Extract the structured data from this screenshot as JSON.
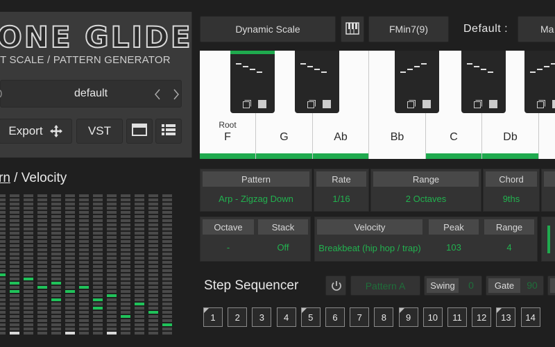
{
  "app": {
    "logo": "ONE GLIDE",
    "subtitle": "T SCALE / PATTERN GENERATOR"
  },
  "preset": {
    "name": "default"
  },
  "left_buttons": {
    "export": "Export",
    "vst": "VST"
  },
  "topbar": {
    "mode": "Dynamic Scale",
    "chord": "FMin7(9)",
    "default_label": "Default :",
    "default_value": "Ma"
  },
  "piano": {
    "root_label": "Root",
    "white_keys": [
      {
        "note": "F",
        "active": true
      },
      {
        "note": "G",
        "active": true
      },
      {
        "note": "Ab",
        "active": true
      },
      {
        "note": "Bb",
        "active": false
      },
      {
        "note": "C",
        "active": true
      },
      {
        "note": "Db",
        "active": true
      }
    ],
    "black_keys_active": [
      true,
      false,
      false,
      false,
      false
    ]
  },
  "pattern_velocity": {
    "title_a": "rn",
    "title_sep": " / ",
    "title_b": "Velocity"
  },
  "params": {
    "row1": [
      {
        "header": "Pattern",
        "value": "Arp - Zigzag Down"
      },
      {
        "header": "Rate",
        "value": "1/16"
      },
      {
        "header": "Range",
        "value": "2 Octaves"
      },
      {
        "header": "Chord",
        "value": "9ths"
      }
    ],
    "row2": [
      {
        "header": "Octave",
        "value": "-"
      },
      {
        "header": "Stack",
        "value": "Off"
      },
      {
        "header": "Velocity",
        "value": "Breakbeat (hip hop / trap)"
      },
      {
        "header": "Peak",
        "value": "103"
      },
      {
        "header": "Range",
        "value": "4"
      }
    ]
  },
  "sequencer": {
    "title": "Step Sequencer",
    "pattern": "Pattern A",
    "swing_label": "Swing",
    "swing_value": "0",
    "gate_label": "Gate",
    "gate_value": "90",
    "steps": [
      "1",
      "2",
      "3",
      "4",
      "5",
      "6",
      "7",
      "8",
      "9",
      "10",
      "11",
      "12",
      "13",
      "14"
    ]
  },
  "colors": {
    "accent": "#1faa4e",
    "panel": "#3a3a3a",
    "background": "#1f1f1f"
  }
}
